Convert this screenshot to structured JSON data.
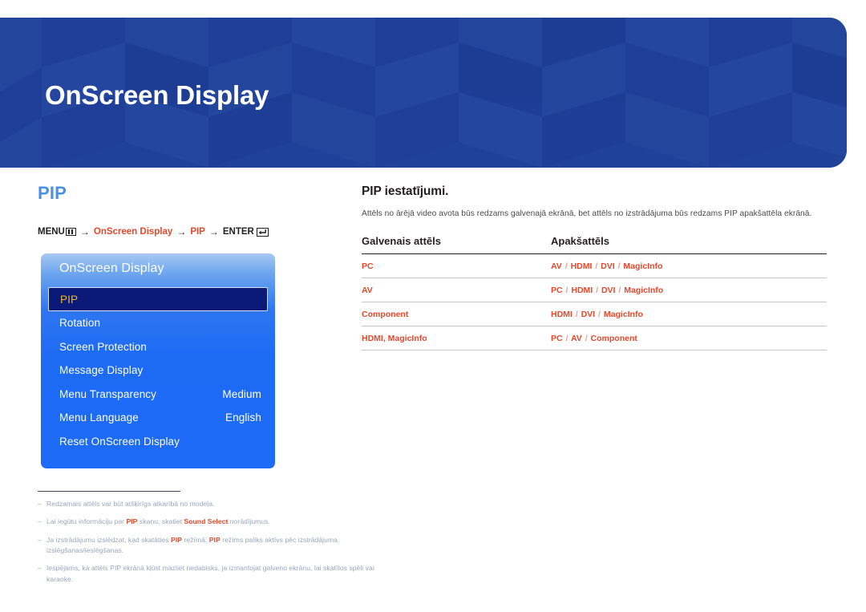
{
  "header": {
    "title": "OnScreen Display",
    "background_color": "#20419a"
  },
  "left": {
    "section_title": "PIP",
    "section_title_color": "#4a8fe0",
    "menu_path": {
      "menu_label": "MENU",
      "menu_icon": "menu-grid-icon",
      "arrow": "→",
      "step1": "OnScreen Display",
      "step2": "PIP",
      "enter_label": "ENTER",
      "enter_icon": "enter-return-icon",
      "accent_color": "#e8472a"
    },
    "osd": {
      "title": "OnScreen Display",
      "selected_index": 0,
      "selected_text_color": "#f2b42a",
      "items": [
        {
          "label": "PIP",
          "value": ""
        },
        {
          "label": "Rotation",
          "value": ""
        },
        {
          "label": "Screen Protection",
          "value": ""
        },
        {
          "label": "Message Display",
          "value": ""
        },
        {
          "label": "Menu Transparency",
          "value": "Medium"
        },
        {
          "label": "Menu Language",
          "value": "English"
        },
        {
          "label": "Reset OnScreen Display",
          "value": ""
        }
      ]
    }
  },
  "right": {
    "title": "PIP iestatījumi.",
    "description": "Attēls no ārējā video avota būs redzams galvenajā ekrānā, bet attēls no izstrādājuma būs redzams PIP apakšattēla ekrānā.",
    "table": {
      "headers": [
        "Galvenais attēls",
        "Apakšattēls"
      ],
      "rows": [
        {
          "main": "PC",
          "sub": "AV / HDMI / DVI / MagicInfo"
        },
        {
          "main": "AV",
          "sub": "PC / HDMI / DVI / MagicInfo"
        },
        {
          "main": "Component",
          "sub": "HDMI / DVI / MagicInfo"
        },
        {
          "main": "HDMI, MagicInfo",
          "sub": "PC / AV / Component"
        }
      ],
      "cell_color": "#e8472a"
    }
  },
  "footnotes": [
    {
      "dash": "–",
      "parts": [
        {
          "t": "Redzamais attēls var būt atšķirīgs atkarībā no modeļa.",
          "hl": false
        }
      ]
    },
    {
      "dash": "–",
      "parts": [
        {
          "t": "Lai iegūtu informāciju par ",
          "hl": false
        },
        {
          "t": "PIP",
          "hl": true
        },
        {
          "t": " skaņu, skatiet ",
          "hl": false
        },
        {
          "t": "Sound Select",
          "hl": true
        },
        {
          "t": " norādījumus.",
          "hl": false
        }
      ]
    },
    {
      "dash": "–",
      "parts": [
        {
          "t": "Ja izstrādājumu izslēdzat, kad skatāties ",
          "hl": false
        },
        {
          "t": "PIP",
          "hl": true
        },
        {
          "t": " režīmā, ",
          "hl": false
        },
        {
          "t": "PIP",
          "hl": true
        },
        {
          "t": " režīms paliks aktīvs pēc izstrādājuma izslēgšanas/ieslēgšanas.",
          "hl": false
        }
      ]
    },
    {
      "dash": "–",
      "parts": [
        {
          "t": "Iespējams, ka attēls PIP ekrānā kļūst mazliet nedabisks, ja izmantojat galveno ekrānu, lai skatītos spēli vai karaoke.",
          "hl": false
        }
      ]
    }
  ]
}
